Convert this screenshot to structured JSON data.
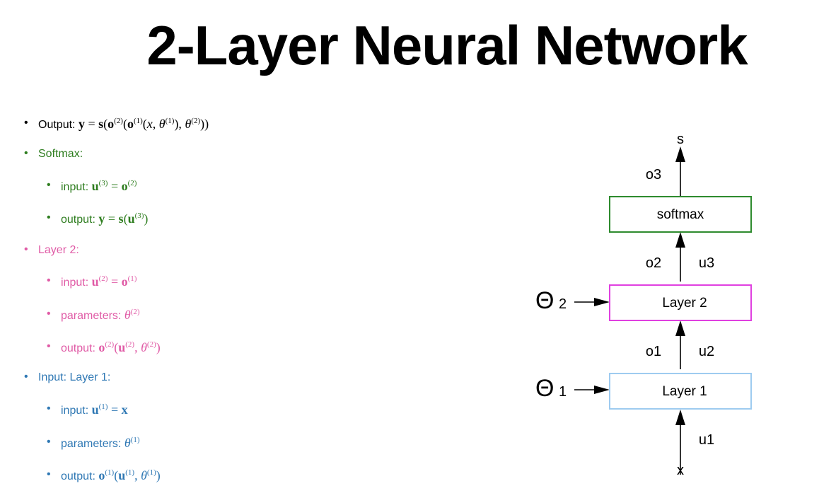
{
  "title": "2-Layer Neural Network",
  "bullets": {
    "output": {
      "label": "Output:"
    },
    "softmax": {
      "label": "Softmax:",
      "input_label": "input:",
      "output_label": "output:"
    },
    "layer2": {
      "label": "Layer 2:",
      "input_label": "input:",
      "params_label": "parameters:",
      "output_label": "output:"
    },
    "layer1": {
      "label": "Input: Layer 1:",
      "input_label": "input:",
      "params_label": "parameters:",
      "output_label": "output:"
    }
  },
  "colors": {
    "output": "#000000",
    "softmax": "#2e7d1f",
    "layer2": "#e05ba6",
    "layer1": "#2f78b4",
    "softmax_box": "#2e8b2e",
    "layer2_box": "#e040e0",
    "layer1_box": "#9ecbf0"
  },
  "diagram": {
    "top_label": "s",
    "bottom_label": "x",
    "o3": "o3",
    "o2": "o2",
    "u3": "u3",
    "o1": "o1",
    "u2": "u2",
    "u1": "u1",
    "softmax_box": "softmax",
    "layer2_box": "Layer 2",
    "layer1_box": "Layer 1",
    "theta2_symbol": "Θ",
    "theta2_sub": "2",
    "theta1_symbol": "Θ",
    "theta1_sub": "1"
  }
}
